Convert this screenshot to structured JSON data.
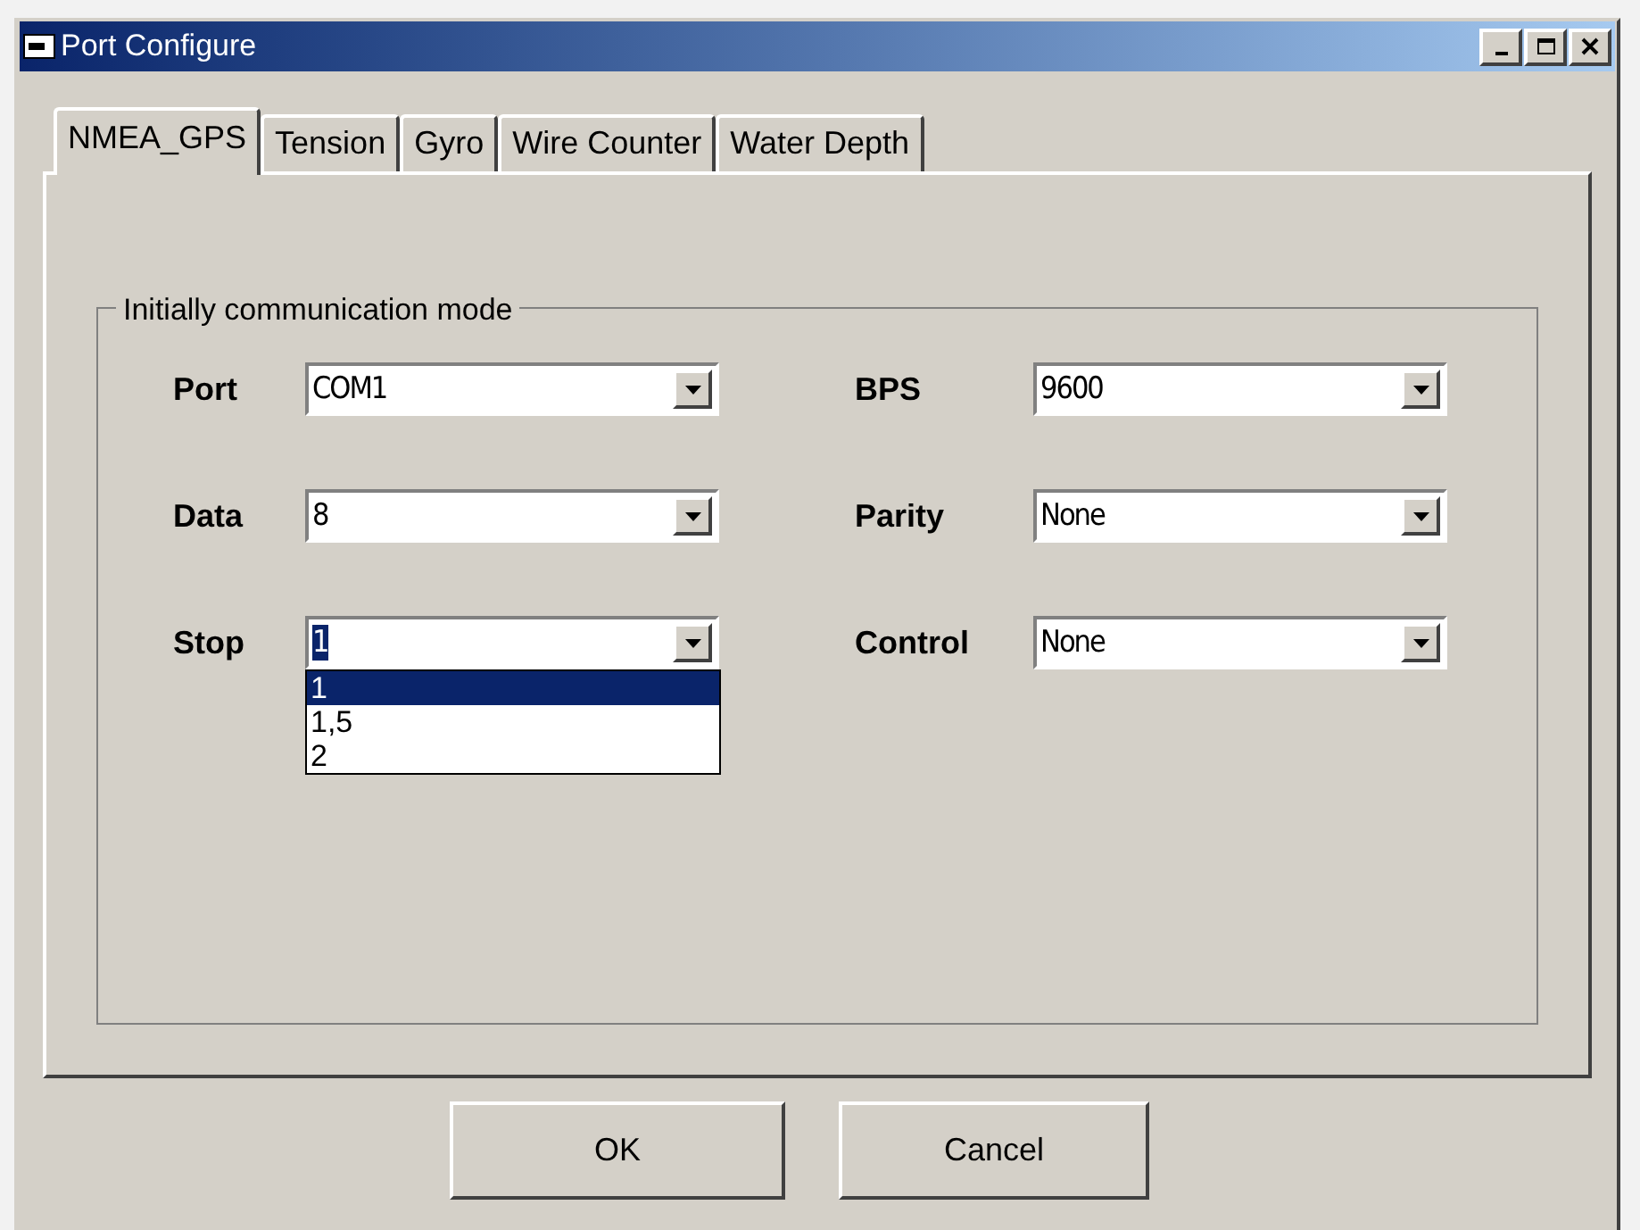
{
  "window": {
    "title": "Port Configure"
  },
  "tabs": [
    {
      "label": "NMEA_GPS",
      "selected": true
    },
    {
      "label": "Tension",
      "selected": false
    },
    {
      "label": "Gyro",
      "selected": false
    },
    {
      "label": "Wire Counter",
      "selected": false
    },
    {
      "label": "Water Depth",
      "selected": false
    }
  ],
  "group": {
    "title": "Initially communication mode",
    "fields": [
      {
        "label": "Port",
        "value": "COM1",
        "open": false
      },
      {
        "label": "BPS",
        "value": "9600",
        "open": false
      },
      {
        "label": "Data",
        "value": "8",
        "open": false
      },
      {
        "label": "Parity",
        "value": "None",
        "open": false
      },
      {
        "label": "Stop",
        "value": "1",
        "open": true,
        "options": [
          {
            "label": "1",
            "selected": true
          },
          {
            "label": "1,5",
            "selected": false
          },
          {
            "label": "2",
            "selected": false
          }
        ]
      },
      {
        "label": "Control",
        "value": "None",
        "open": false
      }
    ]
  },
  "buttons": [
    "OK",
    "Cancel"
  ]
}
